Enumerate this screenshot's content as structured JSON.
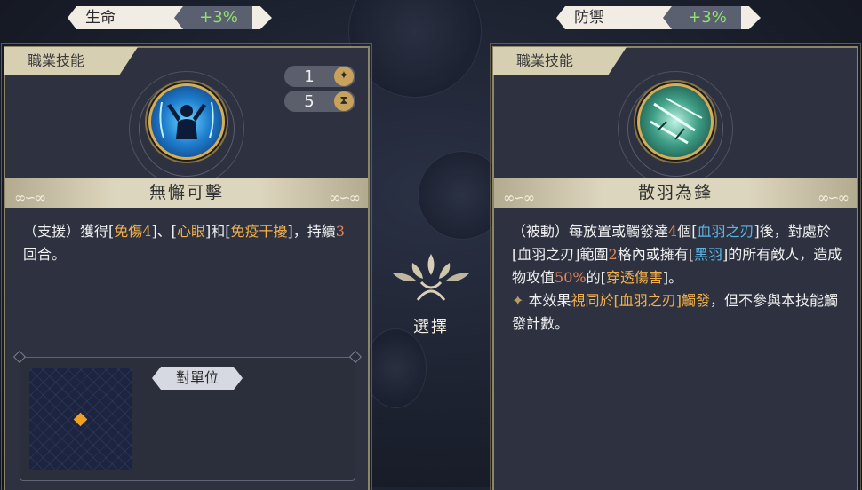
{
  "stats": {
    "left": {
      "name": "生命",
      "value": "+3%"
    },
    "right": {
      "name": "防禦",
      "value": "+3%"
    }
  },
  "left_panel": {
    "tab": "職業技能",
    "cost_value": "1",
    "cost_icon": "sparkle-icon",
    "cooldown_value": "5",
    "cooldown_icon": "hourglass-icon",
    "skill_name": "無懈可擊",
    "desc": {
      "p1": "（支援）獲得[",
      "k1": "免傷4",
      "p2": "]、[",
      "k2": "心眼",
      "p3": "]和[",
      "k3": "免疫干擾",
      "p4": "]，持續",
      "n1": "3",
      "p5": "回合。"
    },
    "range_label": "對單位"
  },
  "center": {
    "label": "選擇"
  },
  "right_panel": {
    "tab": "職業技能",
    "skill_name": "散羽為鋒",
    "desc": {
      "a1": "（被動）每放置或觸發達",
      "a_n": "4",
      "a2": "個[",
      "a_k": "血羽之刃",
      "a3": "]後，對處於[血羽之刃]範圍",
      "a_n2": "2",
      "a4": "格內或擁有[",
      "a_k2": "黑羽",
      "a5": "]的所有敵人，造成物攻值",
      "a_p": "50%",
      "a6": "的[",
      "a_k3": "穿透傷害",
      "a7": "]。",
      "b0": "✦",
      "b1": " 本效果",
      "b_k": "視同於[血羽之刃]觸發",
      "b2": "，但不參與本技能觸發計數。"
    }
  },
  "colors": {
    "accent_orange": "#f3b04a",
    "accent_blue": "#5fb5e6",
    "accent_red": "#e58458",
    "stat_green": "#8fe06a"
  }
}
